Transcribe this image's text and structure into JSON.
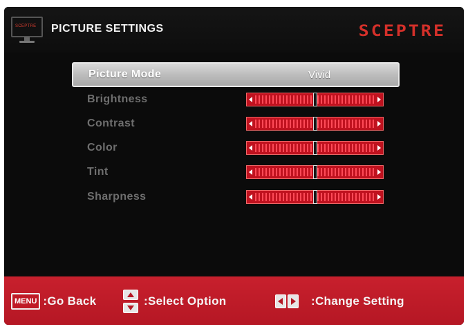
{
  "header": {
    "tv_icon_text": "SCEPTRE",
    "title": "PICTURE SETTINGS",
    "brand": "SCEPTRE"
  },
  "menu": {
    "picture_mode": {
      "label": "Picture Mode",
      "value": "Vivid"
    },
    "sliders": [
      {
        "label": "Brightness",
        "level": 0.5
      },
      {
        "label": "Contrast",
        "level": 0.5
      },
      {
        "label": "Color",
        "level": 0.5
      },
      {
        "label": "Tint",
        "level": 0.5
      },
      {
        "label": "Sharpness",
        "level": 0.5
      }
    ]
  },
  "footer": {
    "menu_key": "MENU",
    "go_back": ":Go Back",
    "select_option": ":Select Option",
    "change_setting": ":Change Setting"
  },
  "colors": {
    "accent_red": "#c0121f",
    "brand_red": "#d4302a"
  },
  "icons": {
    "tv": "tv-icon",
    "up_down": "up-down-keys-icon",
    "left_right": "left-right-keys-icon"
  }
}
